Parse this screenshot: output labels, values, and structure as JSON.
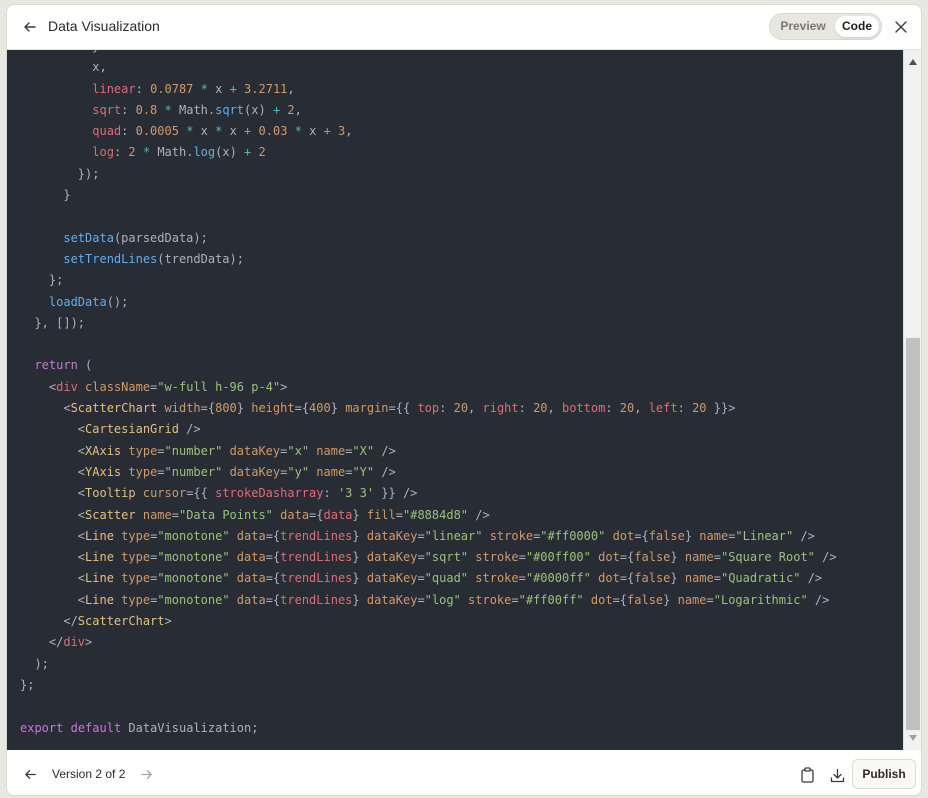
{
  "header": {
    "title": "Data Visualization",
    "preview_label": "Preview",
    "code_label": "Code"
  },
  "footer": {
    "version_label": "Version 2 of 2",
    "publish_label": "Publish"
  },
  "icons": {
    "back": "arrow-left-icon",
    "close": "close-icon",
    "prev": "arrow-left-icon",
    "next": "arrow-right-icon",
    "copy": "clipboard-icon",
    "download": "download-icon"
  },
  "colors": {
    "code_bg": "#282c34",
    "keyword": "#c678dd",
    "function": "#61afef",
    "number": "#d19a66",
    "string": "#98c379",
    "tag": "#e06c75"
  },
  "code": {
    "lines": [
      [
        [
          "plain",
          "          "
        ],
        [
          "plain",
          "y: x"
        ],
        [
          "plain",
          "   "
        ]
      ],
      [
        [
          "plain",
          "          x,"
        ]
      ],
      [
        [
          "plain",
          "          "
        ],
        [
          "prop",
          "linear"
        ],
        [
          "plain",
          ": "
        ],
        [
          "num",
          "0.0787"
        ],
        [
          "plain",
          " "
        ],
        [
          "op",
          "*"
        ],
        [
          "plain",
          " x "
        ],
        [
          "op",
          "+"
        ],
        [
          "plain",
          " "
        ],
        [
          "num",
          "3.2711"
        ],
        [
          "plain",
          ","
        ]
      ],
      [
        [
          "plain",
          "          "
        ],
        [
          "prop",
          "sqrt"
        ],
        [
          "plain",
          ": "
        ],
        [
          "num",
          "0.8"
        ],
        [
          "plain",
          " "
        ],
        [
          "op",
          "*"
        ],
        [
          "plain",
          " Math."
        ],
        [
          "fn",
          "sqrt"
        ],
        [
          "plain",
          "(x) "
        ],
        [
          "op",
          "+"
        ],
        [
          "plain",
          " "
        ],
        [
          "num",
          "2"
        ],
        [
          "plain",
          ","
        ]
      ],
      [
        [
          "plain",
          "          "
        ],
        [
          "prop",
          "quad"
        ],
        [
          "plain",
          ": "
        ],
        [
          "num",
          "0.0005"
        ],
        [
          "plain",
          " "
        ],
        [
          "op",
          "*"
        ],
        [
          "plain",
          " x "
        ],
        [
          "op",
          "*"
        ],
        [
          "plain",
          " x "
        ],
        [
          "op",
          "+"
        ],
        [
          "plain",
          " "
        ],
        [
          "num",
          "0.03"
        ],
        [
          "plain",
          " "
        ],
        [
          "op",
          "*"
        ],
        [
          "plain",
          " x "
        ],
        [
          "op",
          "+"
        ],
        [
          "plain",
          " "
        ],
        [
          "num",
          "3"
        ],
        [
          "plain",
          ","
        ]
      ],
      [
        [
          "plain",
          "          "
        ],
        [
          "prop",
          "log"
        ],
        [
          "plain",
          ": "
        ],
        [
          "num",
          "2"
        ],
        [
          "plain",
          " "
        ],
        [
          "op",
          "*"
        ],
        [
          "plain",
          " Math."
        ],
        [
          "fn",
          "log"
        ],
        [
          "plain",
          "(x) "
        ],
        [
          "op",
          "+"
        ],
        [
          "plain",
          " "
        ],
        [
          "num",
          "2"
        ]
      ],
      [
        [
          "plain",
          "        });"
        ]
      ],
      [
        [
          "plain",
          "      }"
        ]
      ],
      [
        [
          "plain",
          ""
        ]
      ],
      [
        [
          "plain",
          "      "
        ],
        [
          "fn",
          "setData"
        ],
        [
          "plain",
          "(parsedData);"
        ]
      ],
      [
        [
          "plain",
          "      "
        ],
        [
          "fn",
          "setTrendLines"
        ],
        [
          "plain",
          "(trendData);"
        ]
      ],
      [
        [
          "plain",
          "    };"
        ]
      ],
      [
        [
          "plain",
          "    "
        ],
        [
          "fn",
          "loadData"
        ],
        [
          "plain",
          "();"
        ]
      ],
      [
        [
          "plain",
          "  }, []);"
        ]
      ],
      [
        [
          "plain",
          ""
        ]
      ],
      [
        [
          "plain",
          "  "
        ],
        [
          "kw",
          "return"
        ],
        [
          "plain",
          " ("
        ]
      ],
      [
        [
          "plain",
          "    <"
        ],
        [
          "tag",
          "div"
        ],
        [
          "plain",
          " "
        ],
        [
          "attr",
          "className"
        ],
        [
          "plain",
          "="
        ],
        [
          "str",
          "\"w-full h-96 p-4\""
        ],
        [
          "plain",
          ">"
        ]
      ],
      [
        [
          "plain",
          "      <"
        ],
        [
          "comp",
          "ScatterChart"
        ],
        [
          "plain",
          " "
        ],
        [
          "attr",
          "width"
        ],
        [
          "plain",
          "={"
        ],
        [
          "num",
          "800"
        ],
        [
          "plain",
          "} "
        ],
        [
          "attr",
          "height"
        ],
        [
          "plain",
          "={"
        ],
        [
          "num",
          "400"
        ],
        [
          "plain",
          "} "
        ],
        [
          "attr",
          "margin"
        ],
        [
          "plain",
          "={{ "
        ],
        [
          "prop",
          "top"
        ],
        [
          "plain",
          ": "
        ],
        [
          "num",
          "20"
        ],
        [
          "plain",
          ", "
        ],
        [
          "prop",
          "right"
        ],
        [
          "plain",
          ": "
        ],
        [
          "num",
          "20"
        ],
        [
          "plain",
          ", "
        ],
        [
          "prop",
          "bottom"
        ],
        [
          "plain",
          ": "
        ],
        [
          "num",
          "20"
        ],
        [
          "plain",
          ", "
        ],
        [
          "prop",
          "left"
        ],
        [
          "plain",
          ": "
        ],
        [
          "num",
          "20"
        ],
        [
          "plain",
          " }}>"
        ]
      ],
      [
        [
          "plain",
          "        <"
        ],
        [
          "comp",
          "CartesianGrid"
        ],
        [
          "plain",
          " />"
        ]
      ],
      [
        [
          "plain",
          "        <"
        ],
        [
          "comp",
          "XAxis"
        ],
        [
          "plain",
          " "
        ],
        [
          "attr",
          "type"
        ],
        [
          "plain",
          "="
        ],
        [
          "str",
          "\"number\""
        ],
        [
          "plain",
          " "
        ],
        [
          "attr",
          "dataKey"
        ],
        [
          "plain",
          "="
        ],
        [
          "str",
          "\"x\""
        ],
        [
          "plain",
          " "
        ],
        [
          "attr",
          "name"
        ],
        [
          "plain",
          "="
        ],
        [
          "str",
          "\"X\""
        ],
        [
          "plain",
          " />"
        ]
      ],
      [
        [
          "plain",
          "        <"
        ],
        [
          "comp",
          "YAxis"
        ],
        [
          "plain",
          " "
        ],
        [
          "attr",
          "type"
        ],
        [
          "plain",
          "="
        ],
        [
          "str",
          "\"number\""
        ],
        [
          "plain",
          " "
        ],
        [
          "attr",
          "dataKey"
        ],
        [
          "plain",
          "="
        ],
        [
          "str",
          "\"y\""
        ],
        [
          "plain",
          " "
        ],
        [
          "attr",
          "name"
        ],
        [
          "plain",
          "="
        ],
        [
          "str",
          "\"Y\""
        ],
        [
          "plain",
          " />"
        ]
      ],
      [
        [
          "plain",
          "        <"
        ],
        [
          "comp",
          "Tooltip"
        ],
        [
          "plain",
          " "
        ],
        [
          "attr",
          "cursor"
        ],
        [
          "plain",
          "={{ "
        ],
        [
          "prop",
          "strokeDasharray"
        ],
        [
          "plain",
          ": "
        ],
        [
          "str",
          "'3 3'"
        ],
        [
          "plain",
          " }} />"
        ]
      ],
      [
        [
          "plain",
          "        <"
        ],
        [
          "comp",
          "Scatter"
        ],
        [
          "plain",
          " "
        ],
        [
          "attr",
          "name"
        ],
        [
          "plain",
          "="
        ],
        [
          "str",
          "\"Data Points\""
        ],
        [
          "plain",
          " "
        ],
        [
          "attr",
          "data"
        ],
        [
          "plain",
          "={"
        ],
        [
          "prop",
          "data"
        ],
        [
          "plain",
          "} "
        ],
        [
          "attr",
          "fill"
        ],
        [
          "plain",
          "="
        ],
        [
          "str",
          "\"#8884d8\""
        ],
        [
          "plain",
          " />"
        ]
      ],
      [
        [
          "plain",
          "        <"
        ],
        [
          "comp",
          "Line"
        ],
        [
          "plain",
          " "
        ],
        [
          "attr",
          "type"
        ],
        [
          "plain",
          "="
        ],
        [
          "str",
          "\"monotone\""
        ],
        [
          "plain",
          " "
        ],
        [
          "attr",
          "data"
        ],
        [
          "plain",
          "={"
        ],
        [
          "prop",
          "trendLines"
        ],
        [
          "plain",
          "} "
        ],
        [
          "attr",
          "dataKey"
        ],
        [
          "plain",
          "="
        ],
        [
          "str",
          "\"linear\""
        ],
        [
          "plain",
          " "
        ],
        [
          "attr",
          "stroke"
        ],
        [
          "plain",
          "="
        ],
        [
          "str",
          "\"#ff0000\""
        ],
        [
          "plain",
          " "
        ],
        [
          "attr",
          "dot"
        ],
        [
          "plain",
          "={"
        ],
        [
          "num",
          "false"
        ],
        [
          "plain",
          "} "
        ],
        [
          "attr",
          "name"
        ],
        [
          "plain",
          "="
        ],
        [
          "str",
          "\"Linear\""
        ],
        [
          "plain",
          " />"
        ]
      ],
      [
        [
          "plain",
          "        <"
        ],
        [
          "comp",
          "Line"
        ],
        [
          "plain",
          " "
        ],
        [
          "attr",
          "type"
        ],
        [
          "plain",
          "="
        ],
        [
          "str",
          "\"monotone\""
        ],
        [
          "plain",
          " "
        ],
        [
          "attr",
          "data"
        ],
        [
          "plain",
          "={"
        ],
        [
          "prop",
          "trendLines"
        ],
        [
          "plain",
          "} "
        ],
        [
          "attr",
          "dataKey"
        ],
        [
          "plain",
          "="
        ],
        [
          "str",
          "\"sqrt\""
        ],
        [
          "plain",
          " "
        ],
        [
          "attr",
          "stroke"
        ],
        [
          "plain",
          "="
        ],
        [
          "str",
          "\"#00ff00\""
        ],
        [
          "plain",
          " "
        ],
        [
          "attr",
          "dot"
        ],
        [
          "plain",
          "={"
        ],
        [
          "num",
          "false"
        ],
        [
          "plain",
          "} "
        ],
        [
          "attr",
          "name"
        ],
        [
          "plain",
          "="
        ],
        [
          "str",
          "\"Square Root\""
        ],
        [
          "plain",
          " />"
        ]
      ],
      [
        [
          "plain",
          "        <"
        ],
        [
          "comp",
          "Line"
        ],
        [
          "plain",
          " "
        ],
        [
          "attr",
          "type"
        ],
        [
          "plain",
          "="
        ],
        [
          "str",
          "\"monotone\""
        ],
        [
          "plain",
          " "
        ],
        [
          "attr",
          "data"
        ],
        [
          "plain",
          "={"
        ],
        [
          "prop",
          "trendLines"
        ],
        [
          "plain",
          "} "
        ],
        [
          "attr",
          "dataKey"
        ],
        [
          "plain",
          "="
        ],
        [
          "str",
          "\"quad\""
        ],
        [
          "plain",
          " "
        ],
        [
          "attr",
          "stroke"
        ],
        [
          "plain",
          "="
        ],
        [
          "str",
          "\"#0000ff\""
        ],
        [
          "plain",
          " "
        ],
        [
          "attr",
          "dot"
        ],
        [
          "plain",
          "={"
        ],
        [
          "num",
          "false"
        ],
        [
          "plain",
          "} "
        ],
        [
          "attr",
          "name"
        ],
        [
          "plain",
          "="
        ],
        [
          "str",
          "\"Quadratic\""
        ],
        [
          "plain",
          " />"
        ]
      ],
      [
        [
          "plain",
          "        <"
        ],
        [
          "comp",
          "Line"
        ],
        [
          "plain",
          " "
        ],
        [
          "attr",
          "type"
        ],
        [
          "plain",
          "="
        ],
        [
          "str",
          "\"monotone\""
        ],
        [
          "plain",
          " "
        ],
        [
          "attr",
          "data"
        ],
        [
          "plain",
          "={"
        ],
        [
          "prop",
          "trendLines"
        ],
        [
          "plain",
          "} "
        ],
        [
          "attr",
          "dataKey"
        ],
        [
          "plain",
          "="
        ],
        [
          "str",
          "\"log\""
        ],
        [
          "plain",
          " "
        ],
        [
          "attr",
          "stroke"
        ],
        [
          "plain",
          "="
        ],
        [
          "str",
          "\"#ff00ff\""
        ],
        [
          "plain",
          " "
        ],
        [
          "attr",
          "dot"
        ],
        [
          "plain",
          "={"
        ],
        [
          "num",
          "false"
        ],
        [
          "plain",
          "} "
        ],
        [
          "attr",
          "name"
        ],
        [
          "plain",
          "="
        ],
        [
          "str",
          "\"Logarithmic\""
        ],
        [
          "plain",
          " />"
        ]
      ],
      [
        [
          "plain",
          "      </"
        ],
        [
          "comp",
          "ScatterChart"
        ],
        [
          "plain",
          ">"
        ]
      ],
      [
        [
          "plain",
          "    </"
        ],
        [
          "tag",
          "div"
        ],
        [
          "plain",
          ">"
        ]
      ],
      [
        [
          "plain",
          "  );"
        ]
      ],
      [
        [
          "plain",
          "};"
        ]
      ],
      [
        [
          "plain",
          ""
        ]
      ],
      [
        [
          "kw",
          "export"
        ],
        [
          "plain",
          " "
        ],
        [
          "kw",
          "default"
        ],
        [
          "plain",
          " DataVisualization;"
        ]
      ]
    ]
  }
}
